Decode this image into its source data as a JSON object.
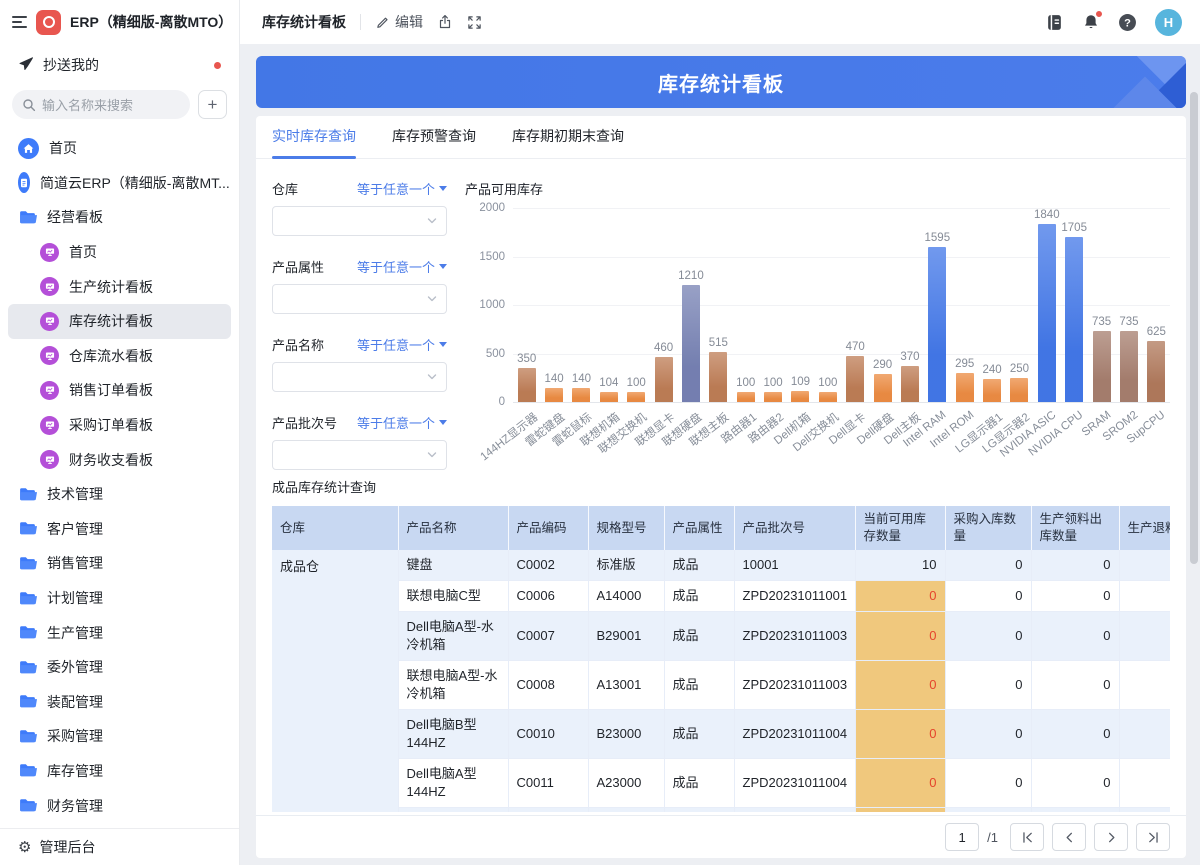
{
  "app": {
    "title": "ERP（精细版-离散MTO）"
  },
  "navbar": {
    "page_title": "库存统计看板",
    "edit_label": "编辑",
    "right_icons": [
      "contacts-icon",
      "notifications-icon",
      "help-icon"
    ],
    "avatar_text": "H"
  },
  "sidebar": {
    "copied_to_me": "抄送我的",
    "search_placeholder": "输入名称来搜索",
    "items": [
      {
        "icon": "home",
        "label": "首页"
      },
      {
        "icon": "doc",
        "label": "简道云ERP（精细版-离散MT..."
      },
      {
        "icon": "folder",
        "label": "经营看板"
      },
      {
        "icon": "dash",
        "label": "首页",
        "indent": true
      },
      {
        "icon": "dash",
        "label": "生产统计看板",
        "indent": true
      },
      {
        "icon": "dash",
        "label": "库存统计看板",
        "indent": true,
        "active": true
      },
      {
        "icon": "dash",
        "label": "仓库流水看板",
        "indent": true
      },
      {
        "icon": "dash",
        "label": "销售订单看板",
        "indent": true
      },
      {
        "icon": "dash",
        "label": "采购订单看板",
        "indent": true
      },
      {
        "icon": "dash",
        "label": "财务收支看板",
        "indent": true
      },
      {
        "icon": "folder",
        "label": "技术管理"
      },
      {
        "icon": "folder",
        "label": "客户管理"
      },
      {
        "icon": "folder",
        "label": "销售管理"
      },
      {
        "icon": "folder",
        "label": "计划管理"
      },
      {
        "icon": "folder",
        "label": "生产管理"
      },
      {
        "icon": "folder",
        "label": "委外管理"
      },
      {
        "icon": "folder",
        "label": "装配管理"
      },
      {
        "icon": "folder",
        "label": "采购管理"
      },
      {
        "icon": "folder",
        "label": "库存管理"
      },
      {
        "icon": "folder",
        "label": "财务管理"
      }
    ],
    "admin": "管理后台"
  },
  "banner": {
    "title": "库存统计看板"
  },
  "tabs": [
    {
      "label": "实时库存查询",
      "active": true
    },
    {
      "label": "库存预警查询",
      "active": false
    },
    {
      "label": "库存期初期末查询",
      "active": false
    }
  ],
  "filters": [
    {
      "label": "仓库",
      "operator": "等于任意一个",
      "value": ""
    },
    {
      "label": "产品属性",
      "operator": "等于任意一个",
      "value": ""
    },
    {
      "label": "产品名称",
      "operator": "等于任意一个",
      "value": ""
    },
    {
      "label": "产品批次号",
      "operator": "等于任意一个",
      "value": ""
    }
  ],
  "chart_data": {
    "type": "bar",
    "title": "产品可用库存",
    "categories": [
      "144HZ显示器",
      "雷蛇键盘",
      "雷蛇鼠标",
      "联想机箱",
      "联想交换机",
      "联想显卡",
      "联想硬盘",
      "联想主板",
      "路由器1",
      "路由器2",
      "Dell机箱",
      "Dell交换机",
      "Dell显卡",
      "Dell硬盘",
      "Dell主板",
      "Intel RAM",
      "Intel ROM",
      "LG显示器1",
      "LG显示器2",
      "NVIDIA ASIC",
      "NVIDIA CPU",
      "SRAM",
      "SROM2",
      "SupCPU"
    ],
    "values": [
      350,
      140,
      140,
      104,
      100,
      460,
      1210,
      515,
      100,
      100,
      109,
      100,
      470,
      290,
      370,
      1595,
      295,
      240,
      250,
      1840,
      1705,
      735,
      735,
      625
    ],
    "colors": [
      "#be7d56",
      "#ec8c43",
      "#ec8c43",
      "#ec8c43",
      "#ec8c43",
      "#be7d56",
      "#7681b3",
      "#be7d56",
      "#ec8c43",
      "#ec8c43",
      "#ec8c43",
      "#ec8c43",
      "#be7d56",
      "#ec8c43",
      "#be7d56",
      "#4277e8",
      "#ec8c43",
      "#ec8c43",
      "#ec8c43",
      "#4277e8",
      "#4277e8",
      "#a67e6e",
      "#a67e6e",
      "#b0795c"
    ],
    "xlabel": "",
    "ylabel": "",
    "ylim": [
      0,
      2000
    ],
    "yticks": [
      0,
      500,
      1000,
      1500,
      2000
    ],
    "grid": true,
    "legend": false,
    "value_labels": true
  },
  "table": {
    "title": "成品库存统计查询",
    "columns": [
      "仓库",
      "产品名称",
      "产品编码",
      "规格型号",
      "产品属性",
      "产品批次号",
      "当前可用库存数量",
      "采购入库数量",
      "生产领料出库数量",
      "生产退料数量"
    ],
    "rows": [
      {
        "warehouse": "成品仓",
        "name": "键盘",
        "code": "C0002",
        "spec": "标准版",
        "attr": "成品",
        "batch": "10001",
        "available": "10",
        "available_alert": false,
        "purchase_in": "0",
        "production_out": "0",
        "production_return": ""
      },
      {
        "warehouse": "",
        "name": "联想电脑C型",
        "code": "C0006",
        "spec": "A14000",
        "attr": "成品",
        "batch": "ZPD20231011001",
        "available": "0",
        "available_alert": true,
        "purchase_in": "0",
        "production_out": "0",
        "production_return": ""
      },
      {
        "warehouse": "",
        "name": "Dell电脑A型-水冷机箱",
        "code": "C0007",
        "spec": "B29001",
        "attr": "成品",
        "batch": "ZPD20231011003",
        "available": "0",
        "available_alert": true,
        "purchase_in": "0",
        "production_out": "0",
        "production_return": ""
      },
      {
        "warehouse": "",
        "name": "联想电脑A型-水冷机箱",
        "code": "C0008",
        "spec": "A13001",
        "attr": "成品",
        "batch": "ZPD20231011003",
        "available": "0",
        "available_alert": true,
        "purchase_in": "0",
        "production_out": "0",
        "production_return": ""
      },
      {
        "warehouse": "",
        "name": "Dell电脑B型 144HZ",
        "code": "C0010",
        "spec": "B23000",
        "attr": "成品",
        "batch": "ZPD20231011004",
        "available": "0",
        "available_alert": true,
        "purchase_in": "0",
        "production_out": "0",
        "production_return": ""
      },
      {
        "warehouse": "",
        "name": "Dell电脑A型 144HZ",
        "code": "C0011",
        "spec": "A23000",
        "attr": "成品",
        "batch": "ZPD20231011004",
        "available": "0",
        "available_alert": true,
        "purchase_in": "0",
        "production_out": "0",
        "production_return": ""
      }
    ]
  },
  "pagination": {
    "current": "1",
    "total": "/1"
  }
}
